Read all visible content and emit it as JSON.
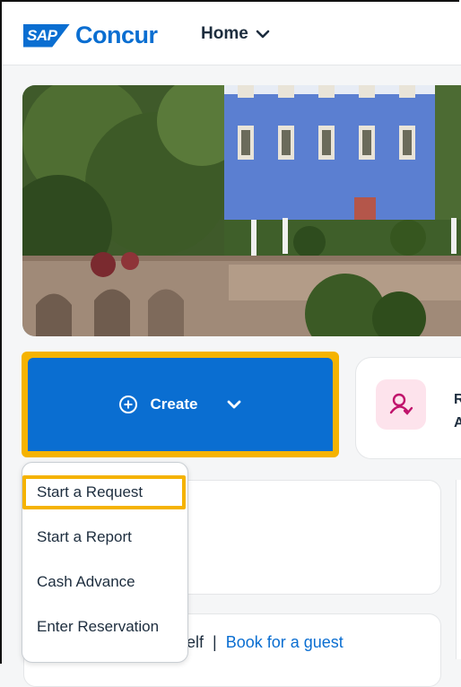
{
  "app": {
    "logo_sap": "SAP",
    "logo_name": "Concur",
    "nav_home": "Home"
  },
  "hero": {
    "alt": "European riverside manor hero image"
  },
  "create": {
    "label": "Create"
  },
  "approvals": {
    "label_line1": "R",
    "label_line2": "A"
  },
  "create_menu": {
    "items": [
      "Start a Request",
      "Start a Report",
      "Cash Advance",
      "Enter Reservation"
    ]
  },
  "booking": {
    "self_fragment": "elf",
    "separator": "|",
    "guest_link": "Book for a guest"
  },
  "colors": {
    "brand": "#0a6ed1",
    "highlight": "#f5b301",
    "approval_bg": "#fde3ec",
    "approval_icon": "#c0136b"
  }
}
